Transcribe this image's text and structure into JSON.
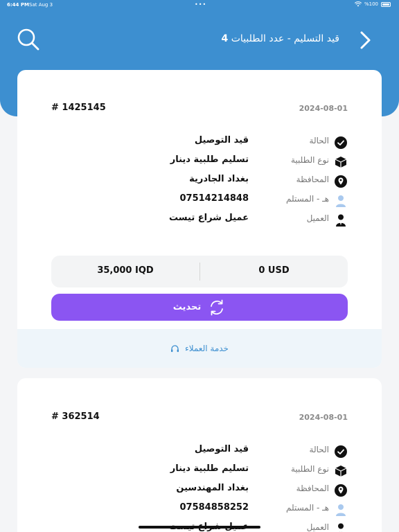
{
  "status_bar": {
    "time": "6:44 PM",
    "date": "Sat Aug 3",
    "dots": "•••",
    "battery": "%100"
  },
  "header": {
    "title": "قيد التسليم - عدد الطلبيات",
    "count": "4"
  },
  "labels": {
    "status": "الحالة",
    "order_type": "نوع الطلبية",
    "governorate": "المحافظة",
    "recipient_phone": "هـ - المستلم",
    "client": "العميل"
  },
  "orders": [
    {
      "number": "# 1425145",
      "date": "2024-08-01",
      "status": "قيد التوصيل",
      "order_type": "تسليم طلبية دينار",
      "governorate": "بغداد الجادرية",
      "recipient_phone": "07514214848",
      "client": "عميل شراع تيست",
      "amount_iqd": "35,000 IQD",
      "amount_usd": "0 USD",
      "update_label": "تحديث",
      "support_label": "خدمة العملاء"
    },
    {
      "number": "# 362514",
      "date": "2024-08-01",
      "status": "قيد التوصيل",
      "order_type": "تسليم طلبية دينار",
      "governorate": "بغداد المهندسين",
      "recipient_phone": "07584858252",
      "client": "عميل شراع تيست"
    }
  ],
  "colors": {
    "header": "#3d8fd0",
    "accent_button": "#8b55f2",
    "support_bg": "#eef5fa"
  }
}
